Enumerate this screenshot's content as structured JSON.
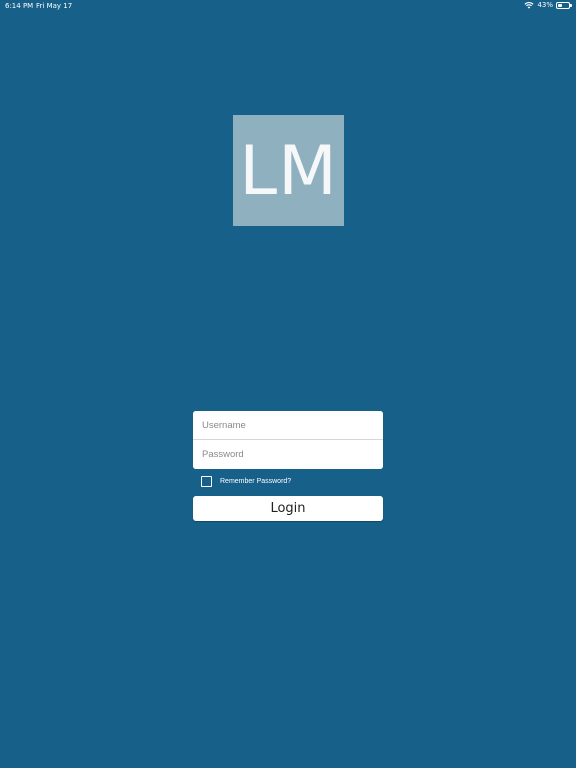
{
  "status_bar": {
    "time": "6:14 PM",
    "date": "Fri May 17",
    "battery": "43%",
    "battery_level": 0.43
  },
  "logo": {
    "text": "LM"
  },
  "login_form": {
    "username_placeholder": "Username",
    "password_placeholder": "Password",
    "remember_label": "Remember Password?",
    "remember_checked": false,
    "login_label": "Login"
  },
  "colors": {
    "background": "#176089",
    "logo_tile": "#8fb1bf",
    "field": "#ffffff"
  }
}
